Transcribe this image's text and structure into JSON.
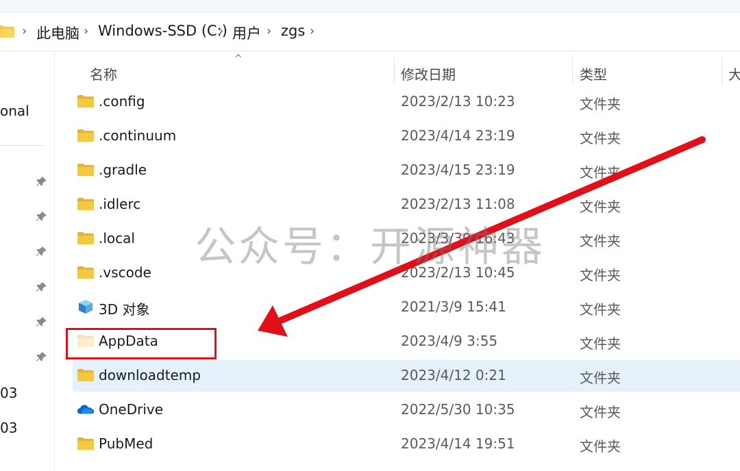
{
  "address": {
    "crumbs": [
      "此电脑",
      "Windows-SSD (C:)",
      "用户",
      "zgs"
    ]
  },
  "sidebar": {
    "partial_label": "onal",
    "numbers": [
      "03",
      "03"
    ]
  },
  "columns": {
    "name": "名称",
    "modified": "修改日期",
    "type": "类型",
    "size": "大"
  },
  "rows": [
    {
      "name": ".config",
      "date": "2023/2/13 10:23",
      "type": "文件夹",
      "icon": "folder-icon"
    },
    {
      "name": ".continuum",
      "date": "2023/4/14 23:19",
      "type": "文件夹",
      "icon": "folder-icon"
    },
    {
      "name": ".gradle",
      "date": "2023/4/15 23:19",
      "type": "文件夹",
      "icon": "folder-icon"
    },
    {
      "name": ".idlerc",
      "date": "2023/2/13 11:08",
      "type": "文件夹",
      "icon": "folder-icon"
    },
    {
      "name": ".local",
      "date": "2023/3/30 16:43",
      "type": "文件夹",
      "icon": "folder-icon"
    },
    {
      "name": ".vscode",
      "date": "2023/2/13 10:45",
      "type": "文件夹",
      "icon": "folder-icon"
    },
    {
      "name": "3D 对象",
      "date": "2021/3/9 15:41",
      "type": "文件夹",
      "icon": "cube-3d-icon"
    },
    {
      "name": "AppData",
      "date": "2023/4/9 3:55",
      "type": "文件夹",
      "icon": "hidden-folder-icon"
    },
    {
      "name": "downloadtemp",
      "date": "2023/4/12 0:21",
      "type": "文件夹",
      "icon": "folder-icon",
      "selected": true
    },
    {
      "name": "OneDrive",
      "date": "2022/5/30 10:35",
      "type": "文件夹",
      "icon": "onedrive-cloud-icon"
    },
    {
      "name": "PubMed",
      "date": "2023/4/14 19:51",
      "type": "文件夹",
      "icon": "folder-icon"
    }
  ],
  "watermark": "公众号：开源神器",
  "colors": {
    "folder": "#f5c842",
    "selection": "#e5f1fb",
    "annotation": "#e0101a"
  }
}
